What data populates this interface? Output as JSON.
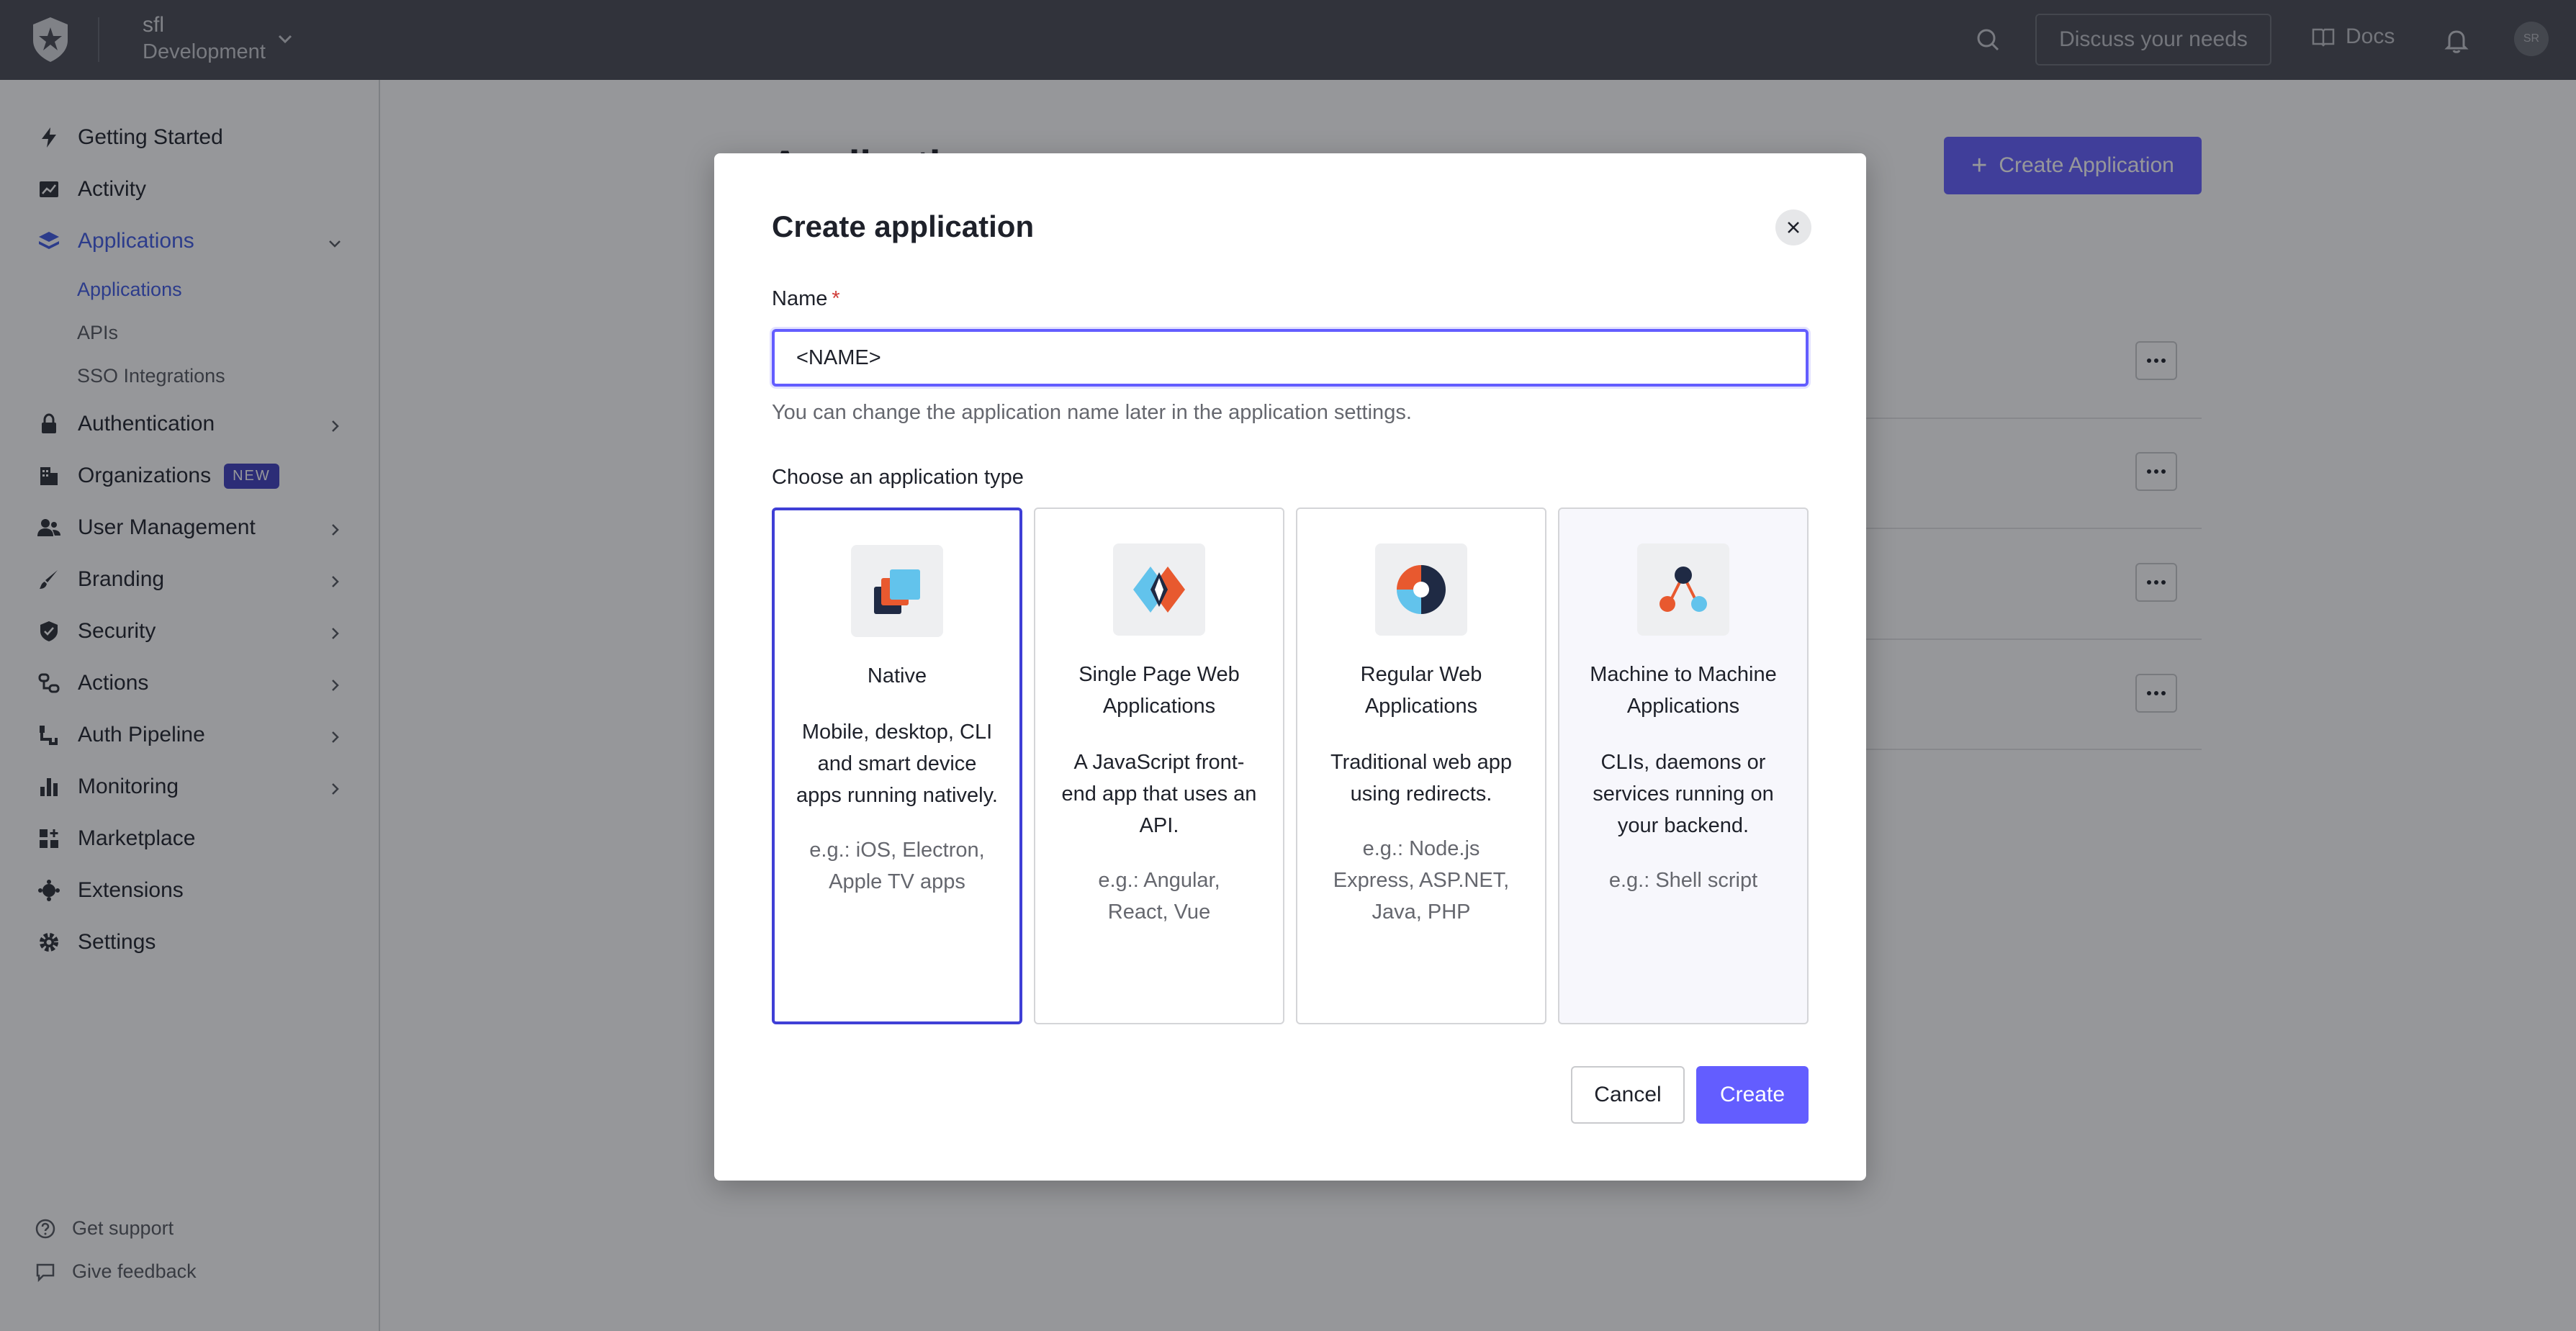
{
  "topbar": {
    "tenant_name": "sfl",
    "tenant_env": "Development",
    "discuss_label": "Discuss your needs",
    "docs_label": "Docs",
    "avatar_initials": "SR"
  },
  "sidebar": {
    "items": [
      {
        "label": "Getting Started",
        "icon": "bolt-icon"
      },
      {
        "label": "Activity",
        "icon": "chart-line-icon"
      },
      {
        "label": "Applications",
        "icon": "layers-icon",
        "active": true,
        "expanded": true
      },
      {
        "label": "Authentication",
        "icon": "lock-icon"
      },
      {
        "label": "Organizations",
        "icon": "building-icon",
        "badge": "NEW"
      },
      {
        "label": "User Management",
        "icon": "users-icon"
      },
      {
        "label": "Branding",
        "icon": "brush-icon"
      },
      {
        "label": "Security",
        "icon": "shield-icon"
      },
      {
        "label": "Actions",
        "icon": "flow-icon"
      },
      {
        "label": "Auth Pipeline",
        "icon": "pipeline-icon"
      },
      {
        "label": "Monitoring",
        "icon": "bar-chart-icon"
      },
      {
        "label": "Marketplace",
        "icon": "grid-plus-icon"
      },
      {
        "label": "Extensions",
        "icon": "puzzle-icon"
      },
      {
        "label": "Settings",
        "icon": "gear-icon"
      }
    ],
    "sub_items": [
      {
        "label": "Applications",
        "active": true
      },
      {
        "label": "APIs"
      },
      {
        "label": "SSO Integrations"
      }
    ],
    "footer": {
      "support": "Get support",
      "feedback": "Give feedback"
    }
  },
  "main": {
    "page_title": "Applications",
    "create_button": "Create Application"
  },
  "modal": {
    "title": "Create application",
    "name_label": "Name",
    "name_value": "<NAME>",
    "name_help": "You can change the application name later in the application settings.",
    "type_label": "Choose an application type",
    "types": [
      {
        "title": "Native",
        "description": "Mobile, desktop, CLI and smart device apps running natively.",
        "example": "e.g.: iOS, Electron, Apple TV apps",
        "selected": true
      },
      {
        "title": "Single Page Web Applications",
        "description": "A JavaScript front-end app that uses an API.",
        "example": "e.g.: Angular, React, Vue"
      },
      {
        "title": "Regular Web Applications",
        "description": "Traditional web app using redirects.",
        "example": "e.g.: Node.js Express, ASP.NET, Java, PHP"
      },
      {
        "title": "Machine to Machine Applications",
        "description": "CLIs, daemons or services running on your backend.",
        "example": "e.g.: Shell script"
      }
    ],
    "cancel_label": "Cancel",
    "create_label": "Create"
  },
  "colors": {
    "accent": "#635dff",
    "topbar": "#1e212a",
    "selected_border": "#3f3fd6"
  }
}
